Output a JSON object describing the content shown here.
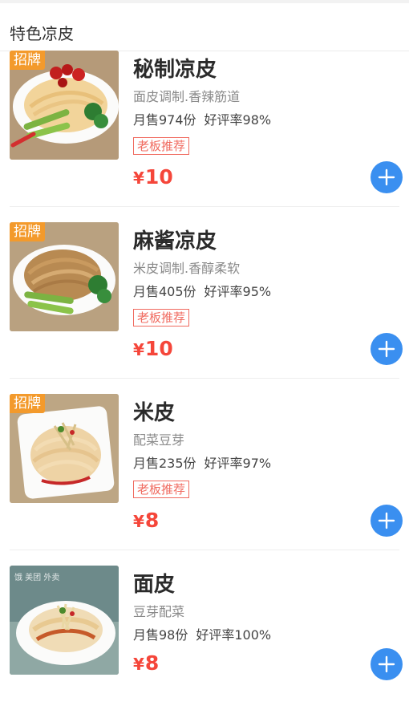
{
  "section": {
    "title": "特色凉皮"
  },
  "items": [
    {
      "badge": "招牌",
      "name": "秘制凉皮",
      "desc": "面皮调制.香辣筋道",
      "sales": "月售974份",
      "rating": "好评率98%",
      "tag": "老板推荐",
      "currency": "¥",
      "price": "10",
      "dish_style": "chili-red-with-cucumber-broccoli"
    },
    {
      "badge": "招牌",
      "name": "麻酱凉皮",
      "desc": "米皮调制.香醇柔软",
      "sales": "月售405份",
      "rating": "好评率95%",
      "tag": "老板推荐",
      "currency": "¥",
      "price": "10",
      "dish_style": "sesame-paste-with-cucumber-broccoli"
    },
    {
      "badge": "招牌",
      "name": "米皮",
      "desc": "配菜豆芽",
      "sales": "月售235份",
      "rating": "好评率97%",
      "tag": "老板推荐",
      "currency": "¥",
      "price": "8",
      "dish_style": "rice-noodles-with-bean-sprouts"
    },
    {
      "badge": "",
      "watermark": "饿 美团 外卖",
      "name": "面皮",
      "desc": "豆芽配菜",
      "sales": "月售98份",
      "rating": "好评率100%",
      "tag": "",
      "currency": "¥",
      "price": "8",
      "dish_style": "wide-noodles-with-chili-oil"
    }
  ],
  "colors": {
    "accent_blue": "#3a8ff0",
    "price_red": "#f5463a",
    "tag_red": "#f06a5f",
    "badge_orange": "#f39a2c"
  },
  "icons": {
    "add_button": "plus-icon"
  }
}
